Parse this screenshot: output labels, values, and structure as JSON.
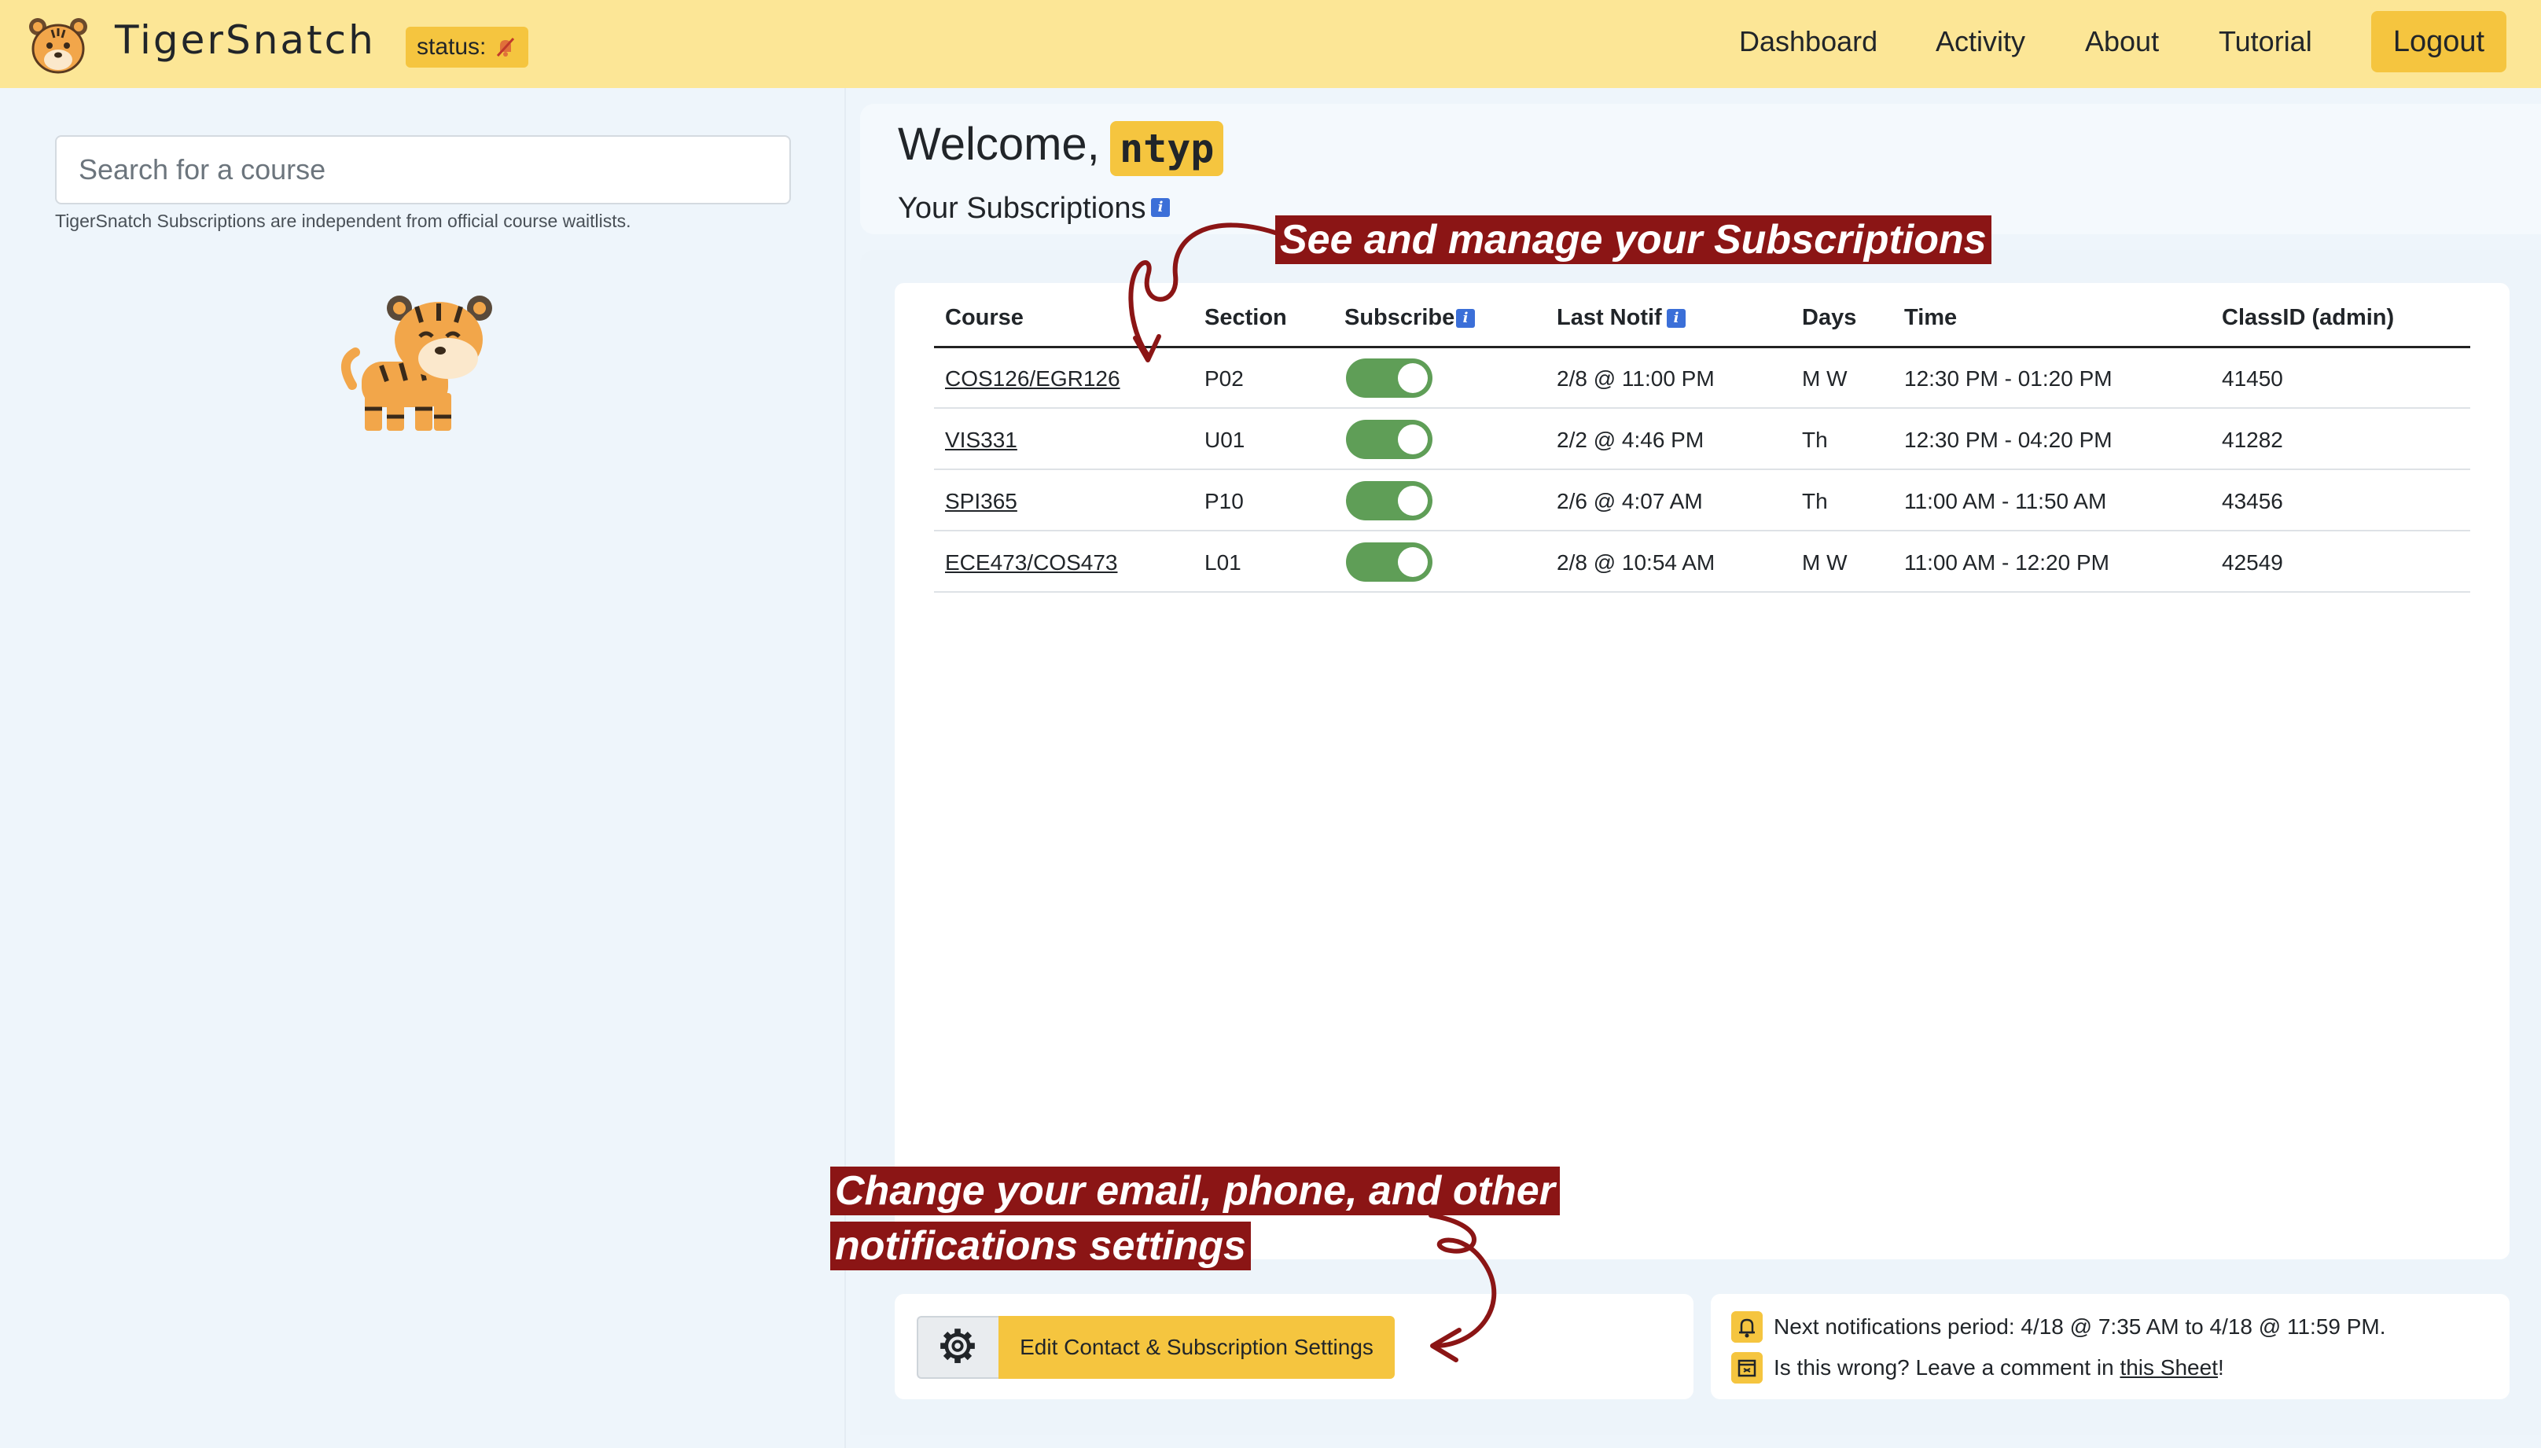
{
  "app": {
    "name": "TigerSnatch",
    "status_label": "status:"
  },
  "nav": {
    "dashboard": "Dashboard",
    "activity": "Activity",
    "about": "About",
    "tutorial": "Tutorial",
    "logout": "Logout"
  },
  "search": {
    "placeholder": "Search for a course",
    "note": "TigerSnatch Subscriptions are independent from official course waitlists."
  },
  "welcome": {
    "greeting": "Welcome,",
    "netid": "ntyp",
    "subscriptions_heading": "Your Subscriptions"
  },
  "table": {
    "headers": {
      "course": "Course",
      "section": "Section",
      "subscribe": "Subscribe",
      "last_notif": "Last Notif",
      "days": "Days",
      "time": "Time",
      "classid": "ClassID (admin)"
    },
    "rows": [
      {
        "course": "COS126/EGR126",
        "section": "P02",
        "subscribed": true,
        "last_notif": "2/8 @ 11:00 PM",
        "days": "M W",
        "time": "12:30 PM - 01:20 PM",
        "classid": "41450"
      },
      {
        "course": "VIS331",
        "section": "U01",
        "subscribed": true,
        "last_notif": "2/2 @ 4:46 PM",
        "days": "Th",
        "time": "12:30 PM - 04:20 PM",
        "classid": "41282"
      },
      {
        "course": "SPI365",
        "section": "P10",
        "subscribed": true,
        "last_notif": "2/6 @ 4:07 AM",
        "days": "Th",
        "time": "11:00 AM - 11:50 AM",
        "classid": "43456"
      },
      {
        "course": "ECE473/COS473",
        "section": "L01",
        "subscribed": true,
        "last_notif": "2/8 @ 10:54 AM",
        "days": "M W",
        "time": "11:00 AM - 12:20 PM",
        "classid": "42549"
      }
    ]
  },
  "settings": {
    "edit_label": "Edit Contact & Subscription Settings"
  },
  "notifications": {
    "period": "Next notifications period: 4/18 @ 7:35 AM to 4/18 @ 11:59 PM.",
    "wrong_prefix": "Is this wrong? Leave a comment in ",
    "sheet_link": "this Sheet",
    "wrong_suffix": "!"
  },
  "annotations": {
    "subscriptions": "See and manage your Subscriptions",
    "settings_line1": "Change your email, phone, and other",
    "settings_line2": "notifications settings"
  },
  "colors": {
    "navbar": "#fce696",
    "accent": "#f5c53f",
    "toggle_on": "#5f9e57",
    "callout": "#8b1515",
    "info": "#3b6fd8"
  },
  "icons": {
    "brand": "tiger-face-icon",
    "status": "muted-bell-icon",
    "info": "info-icon",
    "settings": "gear-icon",
    "bell": "bell-icon",
    "calendar": "calendar-icon",
    "mascot": "tiger-mascot"
  }
}
